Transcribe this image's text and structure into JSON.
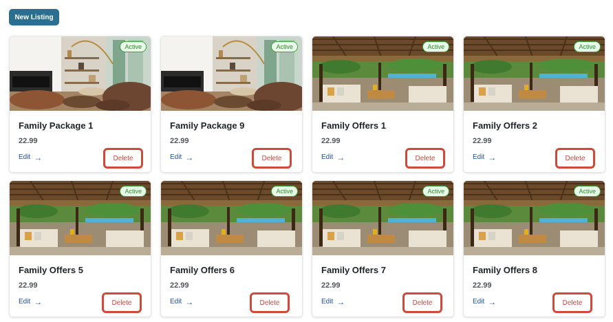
{
  "toolbar": {
    "new_listing_label": "New Listing"
  },
  "listings": [
    {
      "title": "Family Package 1",
      "price": "22.99",
      "status": "Active",
      "edit_label": "Edit",
      "delete_label": "Delete",
      "image": "living-room"
    },
    {
      "title": "Family Package 9",
      "price": "22.99",
      "status": "Active",
      "edit_label": "Edit",
      "delete_label": "Delete",
      "image": "living-room"
    },
    {
      "title": "Family Offers 1",
      "price": "22.99",
      "status": "Active",
      "edit_label": "Edit",
      "delete_label": "Delete",
      "image": "pool-pergola"
    },
    {
      "title": "Family Offers 2",
      "price": "22.99",
      "status": "Active",
      "edit_label": "Edit",
      "delete_label": "Delete",
      "image": "pool-pergola"
    },
    {
      "title": "Family Offers 5",
      "price": "22.99",
      "status": "Active",
      "edit_label": "Edit",
      "delete_label": "Delete",
      "image": "pool-pergola"
    },
    {
      "title": "Family Offers 6",
      "price": "22.99",
      "status": "Active",
      "edit_label": "Edit",
      "delete_label": "Delete",
      "image": "pool-pergola"
    },
    {
      "title": "Family Offers 7",
      "price": "22.99",
      "status": "Active",
      "edit_label": "Edit",
      "delete_label": "Delete",
      "image": "pool-pergola"
    },
    {
      "title": "Family Offers 8",
      "price": "22.99",
      "status": "Active",
      "edit_label": "Edit",
      "delete_label": "Delete",
      "image": "pool-pergola"
    }
  ],
  "colors": {
    "primary": "#2a6f8f",
    "danger": "#d0493b",
    "active": "#3aa63a",
    "link": "#1f4fa0"
  },
  "icons": {
    "edit_arrow": "arrow-right-icon"
  }
}
